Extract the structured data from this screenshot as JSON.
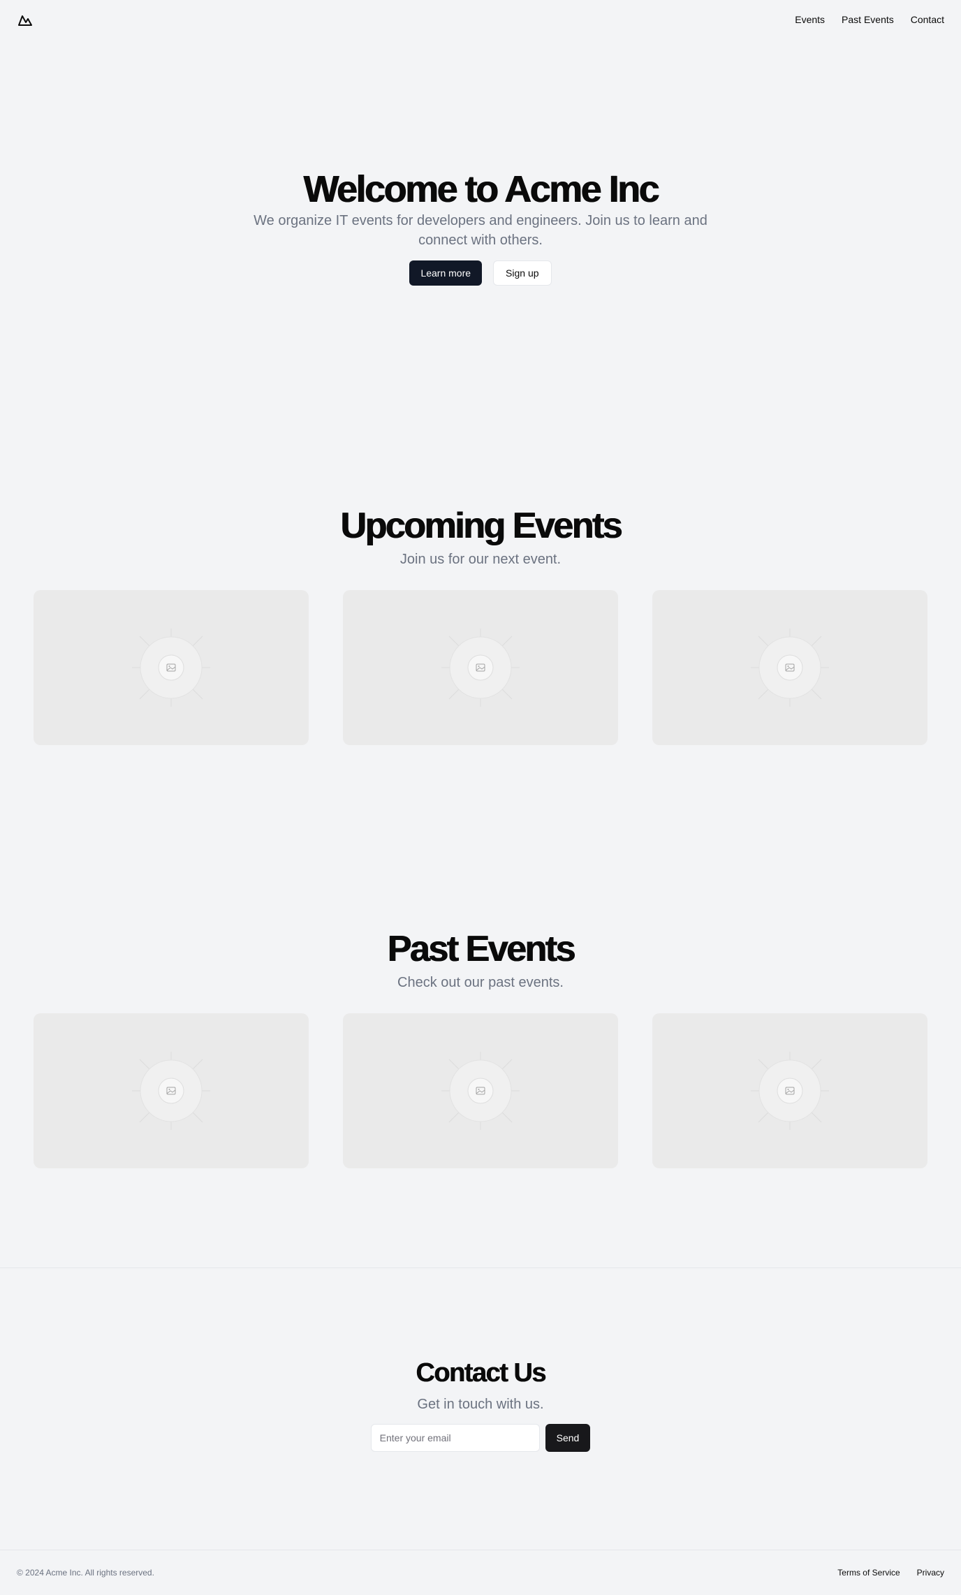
{
  "header": {
    "logo_icon": "mountain-icon",
    "nav": [
      {
        "label": "Events"
      },
      {
        "label": "Past Events"
      },
      {
        "label": "Contact"
      }
    ]
  },
  "hero": {
    "title": "Welcome to Acme Inc",
    "subtitle": "We organize IT events for developers and engineers. Join us to learn and connect with others.",
    "primary_button": "Learn more",
    "secondary_button": "Sign up"
  },
  "upcoming": {
    "title": "Upcoming Events",
    "subtitle": "Join us for our next event.",
    "cards": [
      {
        "image_icon": "image-placeholder-icon"
      },
      {
        "image_icon": "image-placeholder-icon"
      },
      {
        "image_icon": "image-placeholder-icon"
      }
    ]
  },
  "past": {
    "title": "Past Events",
    "subtitle": "Check out our past events.",
    "cards": [
      {
        "image_icon": "image-placeholder-icon"
      },
      {
        "image_icon": "image-placeholder-icon"
      },
      {
        "image_icon": "image-placeholder-icon"
      }
    ]
  },
  "contact": {
    "title": "Contact Us",
    "subtitle": "Get in touch with us.",
    "email_placeholder": "Enter your email",
    "email_value": "",
    "send_label": "Send"
  },
  "footer": {
    "copyright": "© 2024 Acme Inc. All rights reserved.",
    "links": [
      {
        "label": "Terms of Service"
      },
      {
        "label": "Privacy"
      }
    ]
  },
  "colors": {
    "background": "#f3f4f6",
    "primary_button": "#111827",
    "card_placeholder": "#eaeaea",
    "muted_text": "#6b7280"
  }
}
